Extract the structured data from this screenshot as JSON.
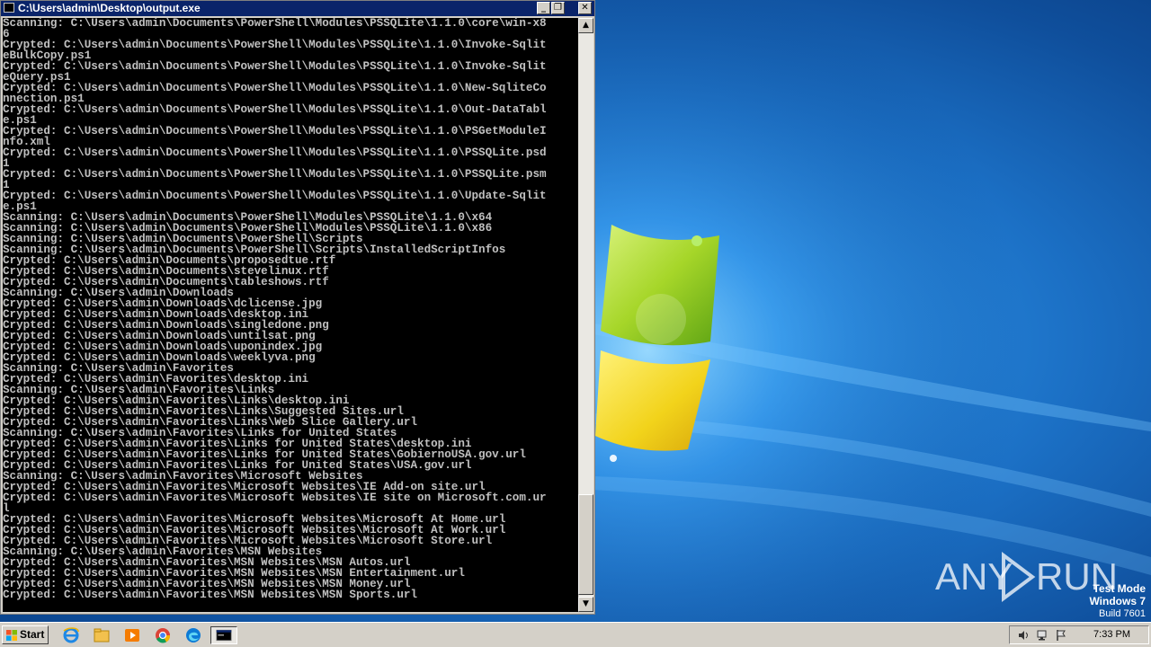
{
  "window": {
    "title": "C:\\Users\\admin\\Desktop\\output.exe",
    "buttons": {
      "minimize": "_",
      "maximize": "❐",
      "close": "✕"
    }
  },
  "console_lines": [
    "Scanning: C:\\Users\\admin\\Documents\\PowerShell\\Modules\\PSSQLite\\1.1.0\\core\\win-x8",
    "6",
    "Crypted: C:\\Users\\admin\\Documents\\PowerShell\\Modules\\PSSQLite\\1.1.0\\Invoke-Sqlit",
    "eBulkCopy.ps1",
    "Crypted: C:\\Users\\admin\\Documents\\PowerShell\\Modules\\PSSQLite\\1.1.0\\Invoke-Sqlit",
    "eQuery.ps1",
    "Crypted: C:\\Users\\admin\\Documents\\PowerShell\\Modules\\PSSQLite\\1.1.0\\New-SqliteCo",
    "nnection.ps1",
    "Crypted: C:\\Users\\admin\\Documents\\PowerShell\\Modules\\PSSQLite\\1.1.0\\Out-DataTabl",
    "e.ps1",
    "Crypted: C:\\Users\\admin\\Documents\\PowerShell\\Modules\\PSSQLite\\1.1.0\\PSGetModuleI",
    "nfo.xml",
    "Crypted: C:\\Users\\admin\\Documents\\PowerShell\\Modules\\PSSQLite\\1.1.0\\PSSQLite.psd",
    "1",
    "Crypted: C:\\Users\\admin\\Documents\\PowerShell\\Modules\\PSSQLite\\1.1.0\\PSSQLite.psm",
    "1",
    "Crypted: C:\\Users\\admin\\Documents\\PowerShell\\Modules\\PSSQLite\\1.1.0\\Update-Sqlit",
    "e.ps1",
    "Scanning: C:\\Users\\admin\\Documents\\PowerShell\\Modules\\PSSQLite\\1.1.0\\x64",
    "Scanning: C:\\Users\\admin\\Documents\\PowerShell\\Modules\\PSSQLite\\1.1.0\\x86",
    "Scanning: C:\\Users\\admin\\Documents\\PowerShell\\Scripts",
    "Scanning: C:\\Users\\admin\\Documents\\PowerShell\\Scripts\\InstalledScriptInfos",
    "Crypted: C:\\Users\\admin\\Documents\\proposedtue.rtf",
    "Crypted: C:\\Users\\admin\\Documents\\stevelinux.rtf",
    "Crypted: C:\\Users\\admin\\Documents\\tableshows.rtf",
    "Scanning: C:\\Users\\admin\\Downloads",
    "Crypted: C:\\Users\\admin\\Downloads\\dclicense.jpg",
    "Crypted: C:\\Users\\admin\\Downloads\\desktop.ini",
    "Crypted: C:\\Users\\admin\\Downloads\\singledone.png",
    "Crypted: C:\\Users\\admin\\Downloads\\untilsat.png",
    "Crypted: C:\\Users\\admin\\Downloads\\uponindex.jpg",
    "Crypted: C:\\Users\\admin\\Downloads\\weeklyva.png",
    "Scanning: C:\\Users\\admin\\Favorites",
    "Crypted: C:\\Users\\admin\\Favorites\\desktop.ini",
    "Scanning: C:\\Users\\admin\\Favorites\\Links",
    "Crypted: C:\\Users\\admin\\Favorites\\Links\\desktop.ini",
    "Crypted: C:\\Users\\admin\\Favorites\\Links\\Suggested Sites.url",
    "Crypted: C:\\Users\\admin\\Favorites\\Links\\Web Slice Gallery.url",
    "Scanning: C:\\Users\\admin\\Favorites\\Links for United States",
    "Crypted: C:\\Users\\admin\\Favorites\\Links for United States\\desktop.ini",
    "Crypted: C:\\Users\\admin\\Favorites\\Links for United States\\GobiernoUSA.gov.url",
    "Crypted: C:\\Users\\admin\\Favorites\\Links for United States\\USA.gov.url",
    "Scanning: C:\\Users\\admin\\Favorites\\Microsoft Websites",
    "Crypted: C:\\Users\\admin\\Favorites\\Microsoft Websites\\IE Add-on site.url",
    "Crypted: C:\\Users\\admin\\Favorites\\Microsoft Websites\\IE site on Microsoft.com.ur",
    "l",
    "Crypted: C:\\Users\\admin\\Favorites\\Microsoft Websites\\Microsoft At Home.url",
    "Crypted: C:\\Users\\admin\\Favorites\\Microsoft Websites\\Microsoft At Work.url",
    "Crypted: C:\\Users\\admin\\Favorites\\Microsoft Websites\\Microsoft Store.url",
    "Scanning: C:\\Users\\admin\\Favorites\\MSN Websites",
    "Crypted: C:\\Users\\admin\\Favorites\\MSN Websites\\MSN Autos.url",
    "Crypted: C:\\Users\\admin\\Favorites\\MSN Websites\\MSN Entertainment.url",
    "Crypted: C:\\Users\\admin\\Favorites\\MSN Websites\\MSN Money.url",
    "Crypted: C:\\Users\\admin\\Favorites\\MSN Websites\\MSN Sports.url"
  ],
  "watermark": {
    "text": "ANY RUN"
  },
  "test_mode": {
    "line1": "Test Mode",
    "line2": "Windows 7",
    "line3": "Build 7601"
  },
  "taskbar": {
    "start_label": "Start",
    "pinned": [
      "ie-icon",
      "explorer-icon",
      "media-player-icon",
      "chrome-icon",
      "edge-icon",
      "console-icon"
    ],
    "clock": "7:33 PM"
  },
  "colors": {
    "console_bg": "#000000",
    "console_text": "#c0c0c0",
    "titlebar": "#0a246a",
    "desktop": "#1b6fc4"
  }
}
